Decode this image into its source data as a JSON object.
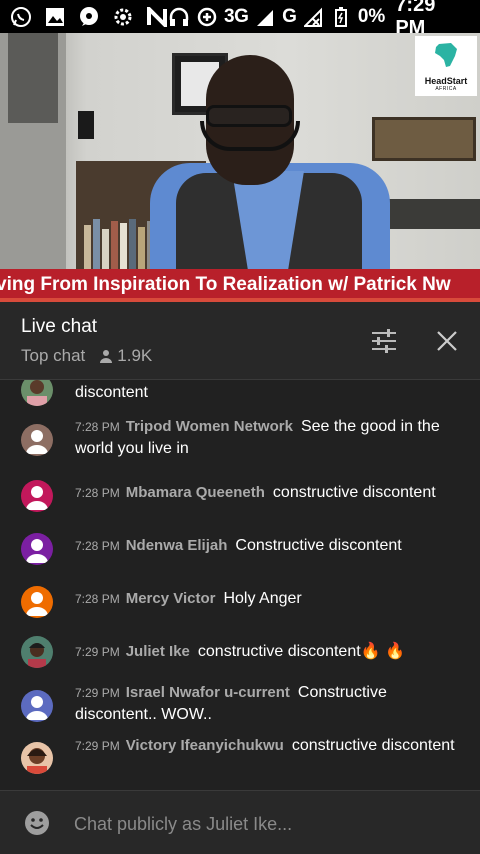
{
  "status_bar": {
    "network": "3G",
    "network_sup": "3G",
    "network2": "G",
    "battery": "0%",
    "time": "7:29 PM"
  },
  "video": {
    "logo_text": "HeadStart",
    "logo_subtext": "AFRICA"
  },
  "ticker": {
    "text": "ving From Inspiration To Realization w/ Patrick Nw"
  },
  "chat_header": {
    "title": "Live chat",
    "mode": "Top chat",
    "viewers": "1.9K"
  },
  "messages": [
    {
      "author": "",
      "time": "",
      "text": "discontent",
      "avatar": "photo-woman-1"
    },
    {
      "author": "Tripod Women Network",
      "time": "7:28 PM",
      "text": "See the good in the world you live in",
      "avatar": "default-brown"
    },
    {
      "author": "Mbamara Queeneth",
      "time": "7:28 PM",
      "text": "constructive discontent",
      "avatar": "default-pink"
    },
    {
      "author": "Ndenwa Elijah",
      "time": "7:28 PM",
      "text": "Constructive discontent",
      "avatar": "default-purple"
    },
    {
      "author": "Mercy Victor",
      "time": "7:28 PM",
      "text": "Holy Anger",
      "avatar": "default-orange"
    },
    {
      "author": "Juliet Ike",
      "time": "7:29 PM",
      "text": "constructive discontent🔥 🔥",
      "avatar": "photo-woman-2"
    },
    {
      "author": "Israel Nwafor u-current",
      "time": "7:29 PM",
      "text": "Constructive discontent.. WOW..",
      "avatar": "default-indigo"
    },
    {
      "author": "Victory Ifeanyichukwu",
      "time": "7:29 PM",
      "text": "constructive discontent",
      "avatar": "photo-woman-3"
    }
  ],
  "avatar_colors": {
    "default-brown": "#8d6e63",
    "default-pink": "#c2185b",
    "default-purple": "#7b1fa2",
    "default-orange": "#ef6c00",
    "default-indigo": "#5c6bc0"
  },
  "input": {
    "placeholder": "Chat publicly as Juliet Ike..."
  },
  "colors": {
    "ticker_bg": "#b8202a",
    "panel_bg": "#212121",
    "header_bg": "#282828"
  }
}
